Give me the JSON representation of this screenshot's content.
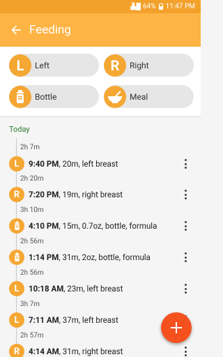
{
  "status_bar": {
    "battery": "64%",
    "time": "11:47 PM"
  },
  "app_bar": {
    "title": "Feeding"
  },
  "quick_add": [
    {
      "badge": "L",
      "icon": "",
      "label": "Left"
    },
    {
      "badge": "R",
      "icon": "",
      "label": "Right"
    },
    {
      "badge": "",
      "icon": "bottle-icon",
      "label": "Bottle"
    },
    {
      "badge": "",
      "icon": "bowl-icon",
      "label": "Meal"
    }
  ],
  "section_title": "Today",
  "timeline": [
    {
      "gap": "2h 7m",
      "badge": "L",
      "icon": "",
      "time": "9:40 PM",
      "details": ", 20m, left breast"
    },
    {
      "gap": "2h 20m",
      "badge": "R",
      "icon": "",
      "time": "7:20 PM",
      "details": ", 19m, right breast"
    },
    {
      "gap": "3h 10m",
      "badge": "",
      "icon": "bottle-icon",
      "time": "4:10 PM",
      "details": ", 15m, 0.7oz, bottle, formula"
    },
    {
      "gap": "2h 56m",
      "badge": "",
      "icon": "bottle-icon",
      "time": "1:14 PM",
      "details": ", 31m, 2oz, bottle, formula"
    },
    {
      "gap": "2h 56m",
      "badge": "L",
      "icon": "",
      "time": "10:18 AM",
      "details": ", 23m, left breast"
    },
    {
      "gap": "3h 7m",
      "badge": "L",
      "icon": "",
      "time": "7:11 AM",
      "details": ", 37m, left breast"
    },
    {
      "gap": "2h 57m",
      "badge": "R",
      "icon": "",
      "time": "4:14 AM",
      "details": ", 31m, right breast"
    }
  ],
  "fab_icon": "plus-icon",
  "colors": {
    "status_bar": "#f3a12b",
    "app_bar": "#fdb444",
    "badge": "#f5a733",
    "fab": "#f4511e",
    "section": "#2e7d32"
  }
}
